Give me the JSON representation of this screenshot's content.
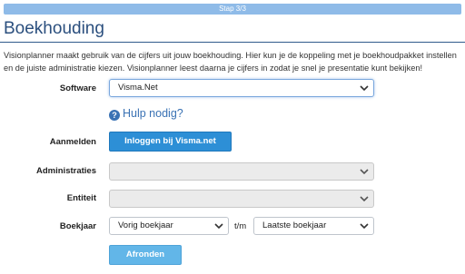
{
  "step": {
    "label": "Stap 3/3"
  },
  "page": {
    "title": "Boekhouding",
    "intro": "Visionplanner maakt gebruik van de cijfers uit jouw boekhouding. Hier kun je de koppeling met je boekhoudpakket instellen en de juiste administratie kiezen. Visionplanner leest daarna je cijfers in zodat je snel je presentatie kunt bekijken!"
  },
  "form": {
    "software": {
      "label": "Software",
      "value": "Visma.Net"
    },
    "help": {
      "icon": "question-circle-icon",
      "label": "Hulp nodig?"
    },
    "login": {
      "label": "Aanmelden",
      "button_label": "Inloggen bij Visma.net"
    },
    "administraties": {
      "label": "Administraties",
      "value": ""
    },
    "entiteit": {
      "label": "Entiteit",
      "value": ""
    },
    "boekjaar": {
      "label": "Boekjaar",
      "from_value": "Vorig boekjaar",
      "separator": "t/m",
      "to_value": "Laatste boekjaar"
    },
    "submit_label": "Afronden"
  },
  "colors": {
    "step_bar": "#8fbbe8",
    "title": "#2b4f7e",
    "button": "#2d8fd6",
    "submit_button": "#62b6e8",
    "link": "#3a72b4"
  }
}
